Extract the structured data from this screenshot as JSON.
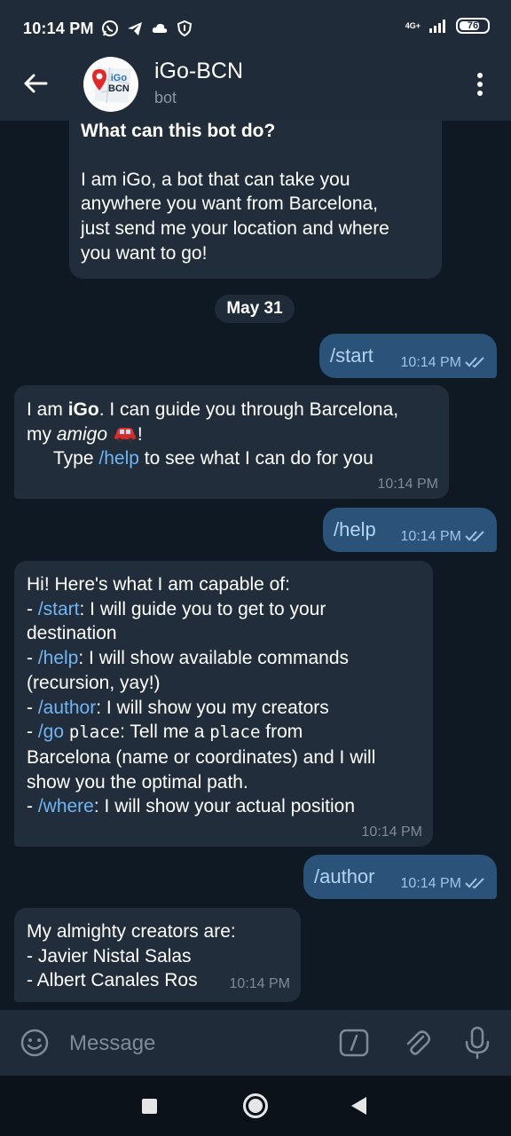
{
  "status_bar": {
    "time": "10:14 PM",
    "network": "4G+",
    "battery": "76",
    "battery_level_percent": 76,
    "icons": [
      "whatsapp-icon",
      "telegram-icon",
      "cloud-icon",
      "shield-icon",
      "signal-icon",
      "battery-icon"
    ]
  },
  "header": {
    "title": "iGo-BCN",
    "subtitle": "bot",
    "avatar_line1": "iGo",
    "avatar_line2": "BCN"
  },
  "chat": {
    "intro": {
      "heading": "What can this bot do?",
      "line1": "I am iGo, a bot that can take you",
      "line2": "anywhere you want from Barcelona,",
      "line3": "just send me your location and where",
      "line4": "you want to go!"
    },
    "date_separator": "May 31",
    "messages": [
      {
        "type": "out",
        "text": "/start",
        "time": "10:14 PM"
      },
      {
        "type": "in",
        "l1_pre": "I am ",
        "l1_bold": "iGo",
        "l1_post": ". I can guide you through Barcelona,",
        "l2_pre": "my ",
        "l2_ital": "amigo",
        "l2_post": "!",
        "l3_pre": "Type ",
        "l3_link": "/help",
        "l3_post": " to see what I can do for you",
        "time": "10:14 PM"
      },
      {
        "type": "out",
        "text": "/help",
        "time": "10:14 PM"
      },
      {
        "type": "in",
        "intro": "Hi! Here's what I am capable of:",
        "dash": "- ",
        "start_cmd": "/start",
        "start_desc1": ": I will guide you to get to your",
        "start_desc2": "destination",
        "help_cmd": "/help",
        "help_desc1": ": I will show available commands",
        "help_desc2": "(recursion, yay!)",
        "author_cmd": "/author",
        "author_desc": ": I will show you my creators",
        "go_cmd": "/go",
        "go_param": "place",
        "go_desc_a": ": Tell me a ",
        "go_param2": "place",
        "go_desc_b": " from",
        "go_desc2": "Barcelona (name or coordinates) and I will",
        "go_desc3": "show you the optimal path.",
        "where_cmd": "/where",
        "where_desc": ": I will show your actual position",
        "time": "10:14 PM"
      },
      {
        "type": "out",
        "text": "/author",
        "time": "10:14 PM"
      },
      {
        "type": "in",
        "line1": "My almighty creators are:",
        "line2": "- Javier Nistal Salas",
        "line3": "- Albert Canales Ros",
        "time": "10:14 PM"
      }
    ]
  },
  "input_bar": {
    "placeholder": "Message"
  },
  "colors": {
    "chat_bg": "#0f1924",
    "header_bg": "#1f2b38",
    "incoming_bubble": "#212d3b",
    "outgoing_bubble": "#2b5278",
    "link": "#71b5f5"
  }
}
